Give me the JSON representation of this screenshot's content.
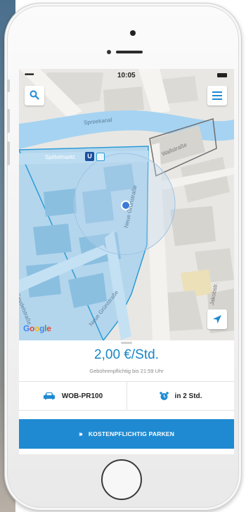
{
  "status_bar": {
    "signal": "•••••",
    "time": "10:05"
  },
  "map": {
    "labels": {
      "spreekanal": "Spreekanal",
      "spittelmarkt": "Spittelmarkt",
      "ubahn": "U",
      "wallstrasse": "Wallstraße",
      "neue_grunstrasse": "Neue Grünstraße",
      "neue_grunstrasse_2": "Neue Grünstraße",
      "seydelstrasse": "Seydelstraße",
      "jakobstrasse": "Jakobstr."
    },
    "attribution": "Google",
    "search_icon": "search-icon",
    "menu_icon": "menu-icon",
    "locate_icon": "location-arrow-icon"
  },
  "parking": {
    "price": "2,00 €/Std.",
    "note": "Gebührenpflichtig bis 21:59 Uhr",
    "plate": "WOB-PR100",
    "reminder": "in 2 Std.",
    "car_icon": "car-icon",
    "alarm_icon": "alarm-clock-icon",
    "button_label": "KOSTENPFLICHTIG PARKEN",
    "button_chevrons": "›››"
  },
  "colors": {
    "accent": "#1f8ad2",
    "price_text": "#1a86c6",
    "zone_fill": "#a9d2ee",
    "water": "#a6d3f2",
    "location_dot": "#3a7bd8"
  }
}
